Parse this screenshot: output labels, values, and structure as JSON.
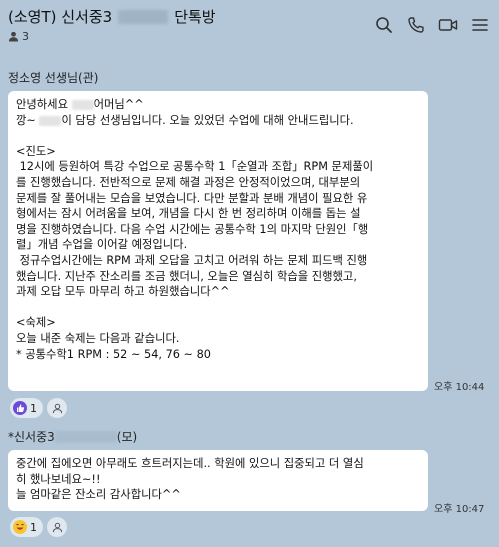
{
  "header": {
    "title_prefix": "(소영T) 신서중3",
    "title_suffix": "단톡방",
    "member_count": "3"
  },
  "messages": [
    {
      "sender": "정소영 선생님(관)",
      "lines": [
        {
          "before": "안녕하세요 ",
          "blur": true,
          "after": "어머님^^"
        },
        {
          "before": "깡~ ",
          "blur": true,
          "after": "이 담당 선생님입니다. 오늘 있었던 수업에 대해 안내드립니다."
        },
        {
          "text": ""
        },
        {
          "text": "<진도>"
        },
        {
          "text": " 12시에 등원하여 특강 수업으로 공통수학 1「순열과 조합」RPM 문제풀이"
        },
        {
          "text": "를 진행했습니다. 전반적으로 문제 해결 과정은 안정적이었으며, 대부분의"
        },
        {
          "text": "문제를 잘 풀어내는 모습을 보였습니다. 다만 분할과 분배 개념이 필요한 유"
        },
        {
          "text": "형에서는 잠시 어려움을 보여, 개념을 다시 한 번 정리하며 이해를 돕는 설"
        },
        {
          "text": "명을 진행하였습니다. 다음 수업 시간에는 공통수학 1의 마지막 단원인「행"
        },
        {
          "text": "렬」개념 수업을 이어갈 예정입니다."
        },
        {
          "text": " 정규수업시간에는 RPM 과제 오답을 고치고 어려워 하는 문제 피드백 진행"
        },
        {
          "text": "했습니다. 지난주 잔소리를 조금 했더니, 오늘은 열심히 학습을 진행했고,"
        },
        {
          "text": "과제 오답 모두 마무리 하고 하원했습니다^^"
        },
        {
          "text": ""
        },
        {
          "text": "<숙제>"
        },
        {
          "text": "오늘 내준 숙제는 다음과 같습니다."
        },
        {
          "text": "* 공통수학1 RPM : 52 ~ 54, 76 ~ 80"
        }
      ],
      "time": "오후 10:44",
      "reaction": {
        "icon": "like-emoji-icon",
        "count": "1"
      }
    },
    {
      "sender_prefix": "*신서중3",
      "sender_suffix": "(모)",
      "lines": [
        {
          "text": "중간에 집에오면 아무래도 흐트러지는데.. 학원에 있으니 집중되고 더 열심"
        },
        {
          "text": "히 했나보네요~!!"
        },
        {
          "text": "늘 엄마같은 잔소리 감사합니다^^"
        }
      ],
      "time": "오후 10:47",
      "reaction": {
        "icon": "laughing-emoji-icon",
        "count": "1"
      }
    }
  ],
  "icons": {
    "search": "search-icon",
    "call": "phone-icon",
    "video": "video-call-icon",
    "menu": "menu-icon"
  }
}
